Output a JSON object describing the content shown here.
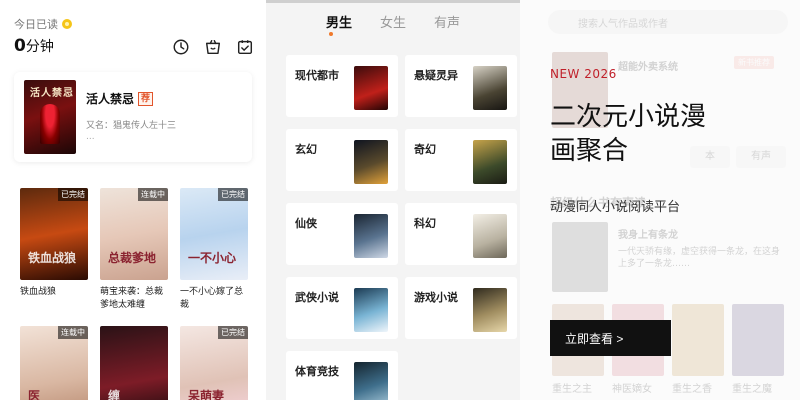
{
  "left": {
    "read_label": "今日已读",
    "read_value": "0",
    "read_unit": "分钟",
    "icons": [
      "clock-icon",
      "shop-basket-icon",
      "checkin-icon"
    ],
    "featured": {
      "cover_text": "活人禁忌",
      "title": "活人禁忌",
      "badge": "荐",
      "alias": "又名：猖鬼传人左十三",
      "more": "..."
    },
    "books": [
      {
        "name": "铁血战狼",
        "tag": "已完结",
        "art": "铁血战狼"
      },
      {
        "name": "萌宝来袭：总裁爹地太难缠",
        "tag": "连载中",
        "art": "总裁爹地"
      },
      {
        "name": "一不小心嫁了总裁",
        "tag": "已完结",
        "art": "一不小心"
      },
      {
        "name": "",
        "tag": "连载中",
        "art": "医"
      },
      {
        "name": "",
        "tag": "",
        "art": "缠"
      },
      {
        "name": "",
        "tag": "已完结",
        "art": "呆萌妻"
      }
    ]
  },
  "middle": {
    "tabs": [
      {
        "label": "男生",
        "active": true
      },
      {
        "label": "女生",
        "active": false
      },
      {
        "label": "有声",
        "active": false
      }
    ],
    "categories": [
      {
        "label": "现代都市"
      },
      {
        "label": "悬疑灵异"
      },
      {
        "label": "玄幻"
      },
      {
        "label": "奇幻"
      },
      {
        "label": "仙侠"
      },
      {
        "label": "科幻"
      },
      {
        "label": "武侠小说"
      },
      {
        "label": "游戏小说"
      },
      {
        "label": "体育竞技"
      }
    ]
  },
  "right": {
    "background": {
      "search_placeholder": "搜索人气作品或作者",
      "item1_title": "超能外卖系统",
      "item1_tag": "新书推荐",
      "pill_a": "本",
      "pill_b": "有声",
      "heading": "超级什么书有声读",
      "item2_title": "我身上有条龙",
      "item2_desc": "一代天骄有缘，虚空获得一条龙，在这身上多了一条龙……",
      "bottom_a": "重生之主",
      "bottom_b": "神医嫡女",
      "bottom_c": "重生之香",
      "bottom_d": "重生之魔"
    },
    "kicker": "NEW 2026",
    "title": "二次元小说漫画聚合",
    "subtitle": "动漫同人小说阅读平台",
    "cta": "立即查看 >"
  },
  "colors": {
    "accent_orange": "#f07a2c",
    "promo_red": "#c0202a",
    "button_black": "#111111"
  }
}
